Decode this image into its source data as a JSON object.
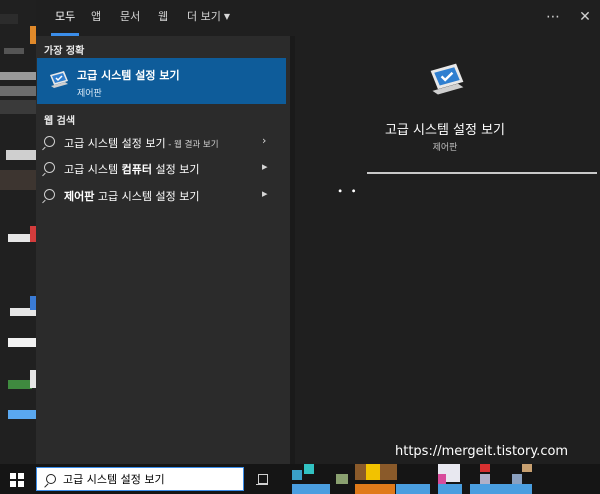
{
  "tabs": [
    {
      "label": "모두",
      "active": true
    },
    {
      "label": "앱",
      "active": false
    },
    {
      "label": "문서",
      "active": false
    },
    {
      "label": "웹",
      "active": false
    },
    {
      "label": "더 보기",
      "active": false
    }
  ],
  "top_icons": {
    "more": "⋯",
    "close": "✕"
  },
  "best_match": {
    "heading": "가장 정확",
    "title": "고급 시스템 설정 보기",
    "subtitle": "제어판",
    "icon": "monitor-check-icon"
  },
  "web_search": {
    "heading": "웹 검색",
    "items": [
      {
        "text": "고급 시스템 설정 보기",
        "suffix": " - 웹 결과 보기",
        "arrow": "›"
      },
      {
        "bold_prefix": "",
        "text": "고급 시스템 ",
        "bold": "컴퓨터",
        "rest": " 설정 보기",
        "arrow": "▸"
      },
      {
        "bold_prefix": "제어판",
        "text": " 고급 시스템 설정 보기",
        "arrow": "▸"
      }
    ]
  },
  "preview": {
    "title": "고급 시스템 설정 보기",
    "subtitle": "제어판",
    "spinner": "∙ ∙",
    "watermark": "https://mergeit.tistory.com"
  },
  "taskbar": {
    "search_value": "고급 시스템 설정 보기",
    "accent": "#3b8eea"
  }
}
